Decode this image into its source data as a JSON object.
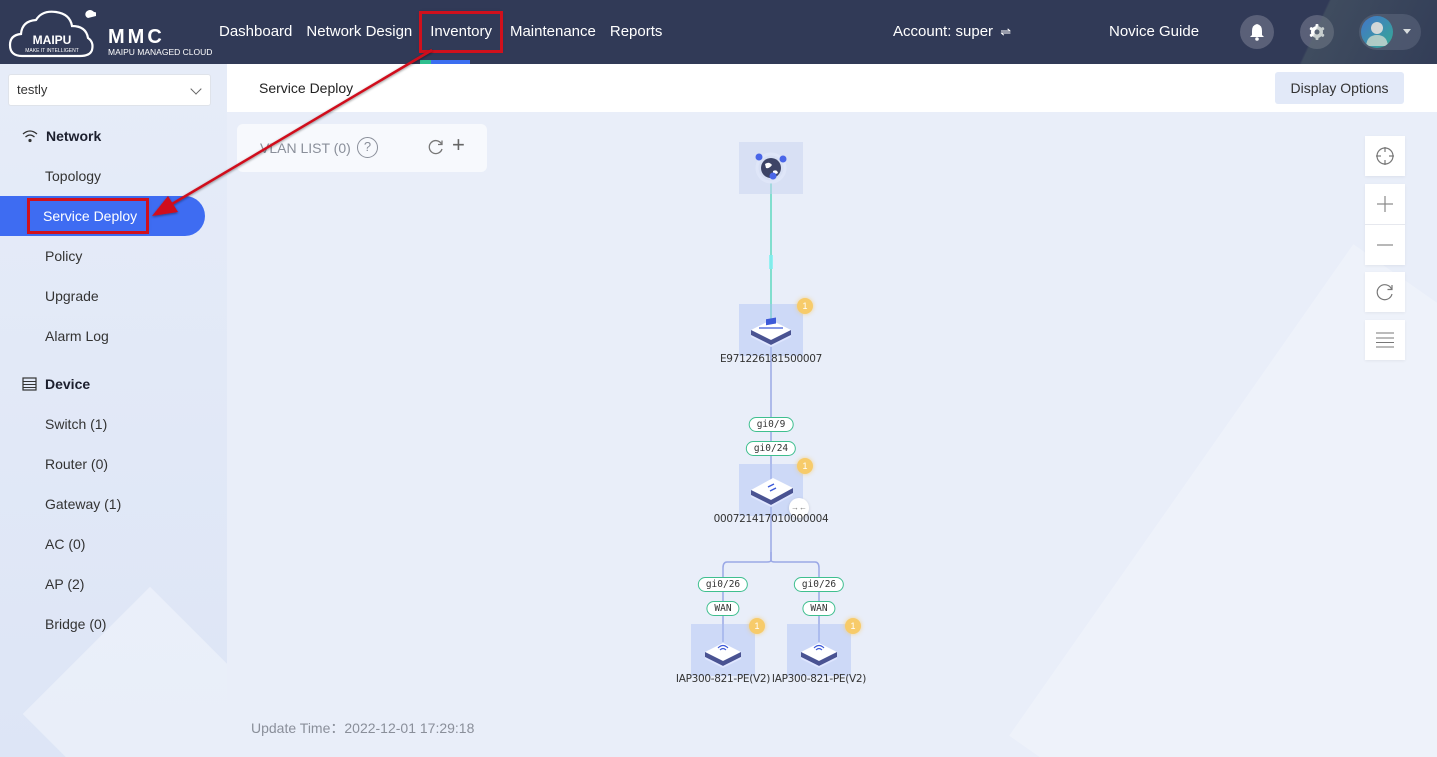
{
  "header": {
    "logo_brand": "MAIPU",
    "logo_tagline": "MAKE IT INTELLIGENT",
    "app_name": "MMC",
    "app_subtitle": "MAIPU MANAGED CLOUD",
    "nav": [
      {
        "label": "Dashboard"
      },
      {
        "label": "Network Design"
      },
      {
        "label": "Inventory",
        "highlighted": true
      },
      {
        "label": "Maintenance"
      },
      {
        "label": "Reports"
      }
    ],
    "account_label": "Account: super",
    "account_switch_icon": "⇌",
    "novice_guide": "Novice Guide",
    "icons": [
      "bell-icon",
      "gear-icon",
      "user-avatar",
      "caret-down-icon"
    ]
  },
  "sidebar": {
    "site_select": {
      "value": "testly"
    },
    "network_section": {
      "title": "Network",
      "icon": "wifi-icon",
      "items": [
        {
          "label": "Topology"
        },
        {
          "label": "Service Deploy",
          "active": true
        },
        {
          "label": "Policy"
        },
        {
          "label": "Upgrade"
        },
        {
          "label": "Alarm Log"
        }
      ]
    },
    "device_section": {
      "title": "Device",
      "icon": "list-icon",
      "items": [
        {
          "label": "Switch (1)"
        },
        {
          "label": "Router (0)"
        },
        {
          "label": "Gateway (1)"
        },
        {
          "label": "AC (0)"
        },
        {
          "label": "AP (2)"
        },
        {
          "label": "Bridge (0)"
        }
      ]
    }
  },
  "main": {
    "breadcrumb": "Service Deploy",
    "display_options": "Display Options",
    "vlan_list": {
      "title": "VLAN LIST (0)",
      "help": "?",
      "add": "+"
    },
    "controls": [
      "locate-icon",
      "zoom-in-icon",
      "zoom-out-icon",
      "refresh-icon",
      "list-icon"
    ],
    "update_time": "Update Time：2022-12-01 17:29:18",
    "topology": {
      "nodes": [
        {
          "id": "internet",
          "type": "internet",
          "label": ""
        },
        {
          "id": "gw",
          "type": "gateway",
          "label": "E971226181500007",
          "alarms": "1"
        },
        {
          "id": "sw",
          "type": "switch",
          "label": "000721417010000004",
          "alarms": "1"
        },
        {
          "id": "ap1",
          "type": "ap",
          "label": "IAP300-821-PE(V2)",
          "alarms": "1"
        },
        {
          "id": "ap2",
          "type": "ap",
          "label": "IAP300-821-PE(V2)",
          "alarms": "1"
        }
      ],
      "ports": {
        "gw_sw_upper": "gi0/9",
        "gw_sw_lower": "gi0/24",
        "sw_ap1": "gi0/26",
        "ap1_wan": "WAN",
        "sw_ap2": "gi0/26",
        "ap2_wan": "WAN"
      },
      "expand_glyph": "→←"
    }
  },
  "colors": {
    "header_bg": "#313a57",
    "accent": "#3e6cf2",
    "annotation": "#d0101c",
    "port_border": "#3fbf8f",
    "alarm_badge": "#f7cb6a",
    "uplink_line": "#5fd8c0",
    "link_line": "#9aa8e6"
  }
}
